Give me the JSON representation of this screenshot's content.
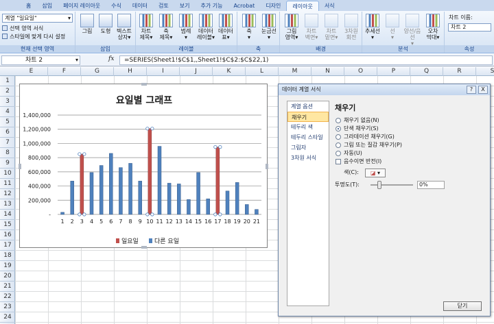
{
  "tabs": [
    "홈",
    "삽입",
    "페이지 레이아웃",
    "수식",
    "데이터",
    "검토",
    "보기",
    "추가 기능",
    "Acrobat",
    "디자인",
    "레이아웃",
    "서식"
  ],
  "active_tab": "레이아웃",
  "ribbon": {
    "current_selection": {
      "dropdown": "계열 \"일요일\"",
      "format_selection": "선택 영역 서식",
      "reset_style": "스타일에 맞게 다시 설정",
      "label": "현재 선택 영역"
    },
    "insert": {
      "label": "삽입",
      "picture": "그림",
      "shapes": "도형",
      "textbox": "텍스트\n상자▾"
    },
    "labels": {
      "label": "레이블",
      "chart_title": "차트\n제목▾",
      "axis_titles": "축\n제목▾",
      "legend": "범례\n▾",
      "data_labels": "데이터\n레이블▾",
      "data_table": "데이터\n표▾"
    },
    "axes": {
      "label": "축",
      "axes": "축\n▾",
      "gridlines": "눈금선\n▾"
    },
    "background": {
      "label": "배경",
      "plot_area": "그림\n영역▾",
      "chart_wall": "차트\n벽면▾",
      "chart_floor": "차트\n밑면▾",
      "rotation_3d": "3차원\n회전"
    },
    "analysis": {
      "label": "분석",
      "trendline": "추세선\n▾",
      "lines": "선\n▾",
      "updown_bars": "양선/음선\n▾",
      "error_bars": "오차\n막대▾"
    },
    "properties": {
      "label": "속성",
      "chart_name_label": "차트 이름:",
      "chart_name": "차트 2"
    }
  },
  "formula_bar": {
    "name_box": "차트 2",
    "fx": "fx",
    "formula": "=SERIES(Sheet1!$C$1,,Sheet1!$C$2:$C$22,1)"
  },
  "columns": [
    "E",
    "F",
    "G",
    "H",
    "I",
    "J",
    "K",
    "L",
    "M",
    "N",
    "O",
    "P",
    "Q",
    "R",
    "S"
  ],
  "rows": [
    "1",
    "2",
    "3",
    "4",
    "5",
    "6",
    "7",
    "8",
    "9",
    "10",
    "11",
    "12",
    "13",
    "14",
    "15",
    "16",
    "17",
    "18",
    "19",
    "20",
    "21",
    "22",
    "23",
    "24"
  ],
  "chart_data": {
    "type": "bar",
    "title": "요일별 그래프",
    "categories": [
      "1",
      "2",
      "3",
      "4",
      "5",
      "6",
      "7",
      "8",
      "9",
      "10",
      "11",
      "12",
      "13",
      "14",
      "15",
      "16",
      "17",
      "18",
      "19",
      "20",
      "21"
    ],
    "ylim": [
      0,
      1400000
    ],
    "yticks": [
      "-",
      "200,000",
      "400,000",
      "600,000",
      "800,000",
      "1,000,000",
      "1,200,000",
      "1,400,000"
    ],
    "grid": true,
    "legend_position": "bottom",
    "series": [
      {
        "name": "일요일",
        "color": "#c0504d",
        "values": [
          null,
          null,
          850000,
          null,
          null,
          null,
          null,
          null,
          null,
          1210000,
          null,
          null,
          null,
          null,
          null,
          null,
          950000,
          null,
          null,
          null,
          null
        ]
      },
      {
        "name": "다른 요일",
        "color": "#4f81bd",
        "values": [
          30000,
          470000,
          null,
          590000,
          690000,
          860000,
          660000,
          720000,
          470000,
          null,
          960000,
          440000,
          430000,
          210000,
          590000,
          220000,
          null,
          330000,
          450000,
          140000,
          70000
        ]
      }
    ]
  },
  "dialog": {
    "title": "데이터 계열 서식",
    "help": "?",
    "close_x": "X",
    "nav": [
      "계열 옵션",
      "채우기",
      "테두리 색",
      "테두리 스타일",
      "그림자",
      "3차원 서식"
    ],
    "active_nav": "채우기",
    "section_title": "채우기",
    "options": [
      {
        "label": "채우기 없음(N)",
        "checked": false
      },
      {
        "label": "단색 채우기(S)",
        "checked": true
      },
      {
        "label": "그라데이션 채우기(G)",
        "checked": false
      },
      {
        "label": "그림 또는 질감 채우기(P)",
        "checked": false
      },
      {
        "label": "자동(U)",
        "checked": false
      }
    ],
    "invert": "음수이면 반전(I)",
    "color_label": "색(C):",
    "transparency_label": "투명도(T):",
    "transparency_value": "0%",
    "close_button": "닫기"
  }
}
